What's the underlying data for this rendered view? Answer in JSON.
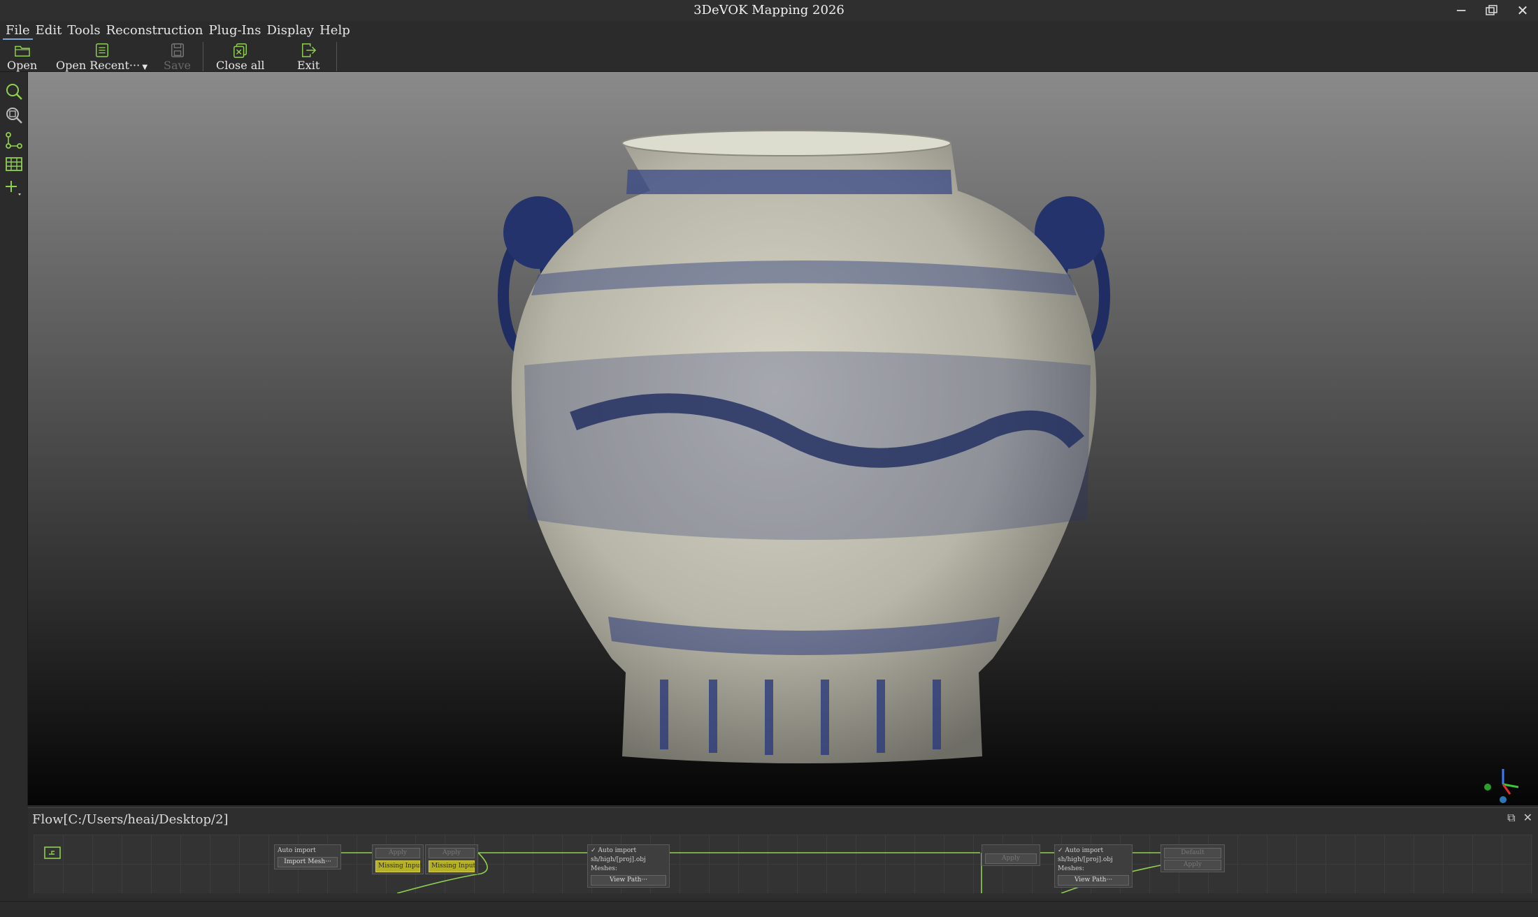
{
  "window": {
    "title": "3DeVOK Mapping 2026"
  },
  "menu": {
    "items": [
      "File",
      "Edit",
      "Tools",
      "Reconstruction",
      "Plug-Ins",
      "Display",
      "Help"
    ]
  },
  "toolbar": {
    "open": "Open",
    "open_recent": "Open Recent···",
    "save": "Save",
    "close_all": "Close all",
    "exit": "Exit"
  },
  "flow": {
    "title": "Flow[C:/Users/heai/Desktop/2]",
    "nodes": {
      "n1": {
        "auto_import": "Auto import",
        "button": "Import Mesh···"
      },
      "n2": {
        "button": "Apply",
        "warn": "Missing Input"
      },
      "n3": {
        "button": "Apply",
        "warn": "Missing Input"
      },
      "n4": {
        "auto_import": "✓ Auto import",
        "path": "sh/high/[proj].obj",
        "meshes": "Meshes:",
        "button": "View Path···"
      },
      "n5": {
        "button": "Apply"
      },
      "n6": {
        "auto_import": "✓ Auto import",
        "path": "sh/high/[proj].obj",
        "meshes": "Meshes:",
        "button": "View Path···"
      },
      "n7": {
        "default": "Default",
        "button": "Apply"
      }
    }
  },
  "colors": {
    "accent": "#7fa8d8",
    "icon_green": "#8fd14f",
    "warn": "#b5b02a"
  }
}
